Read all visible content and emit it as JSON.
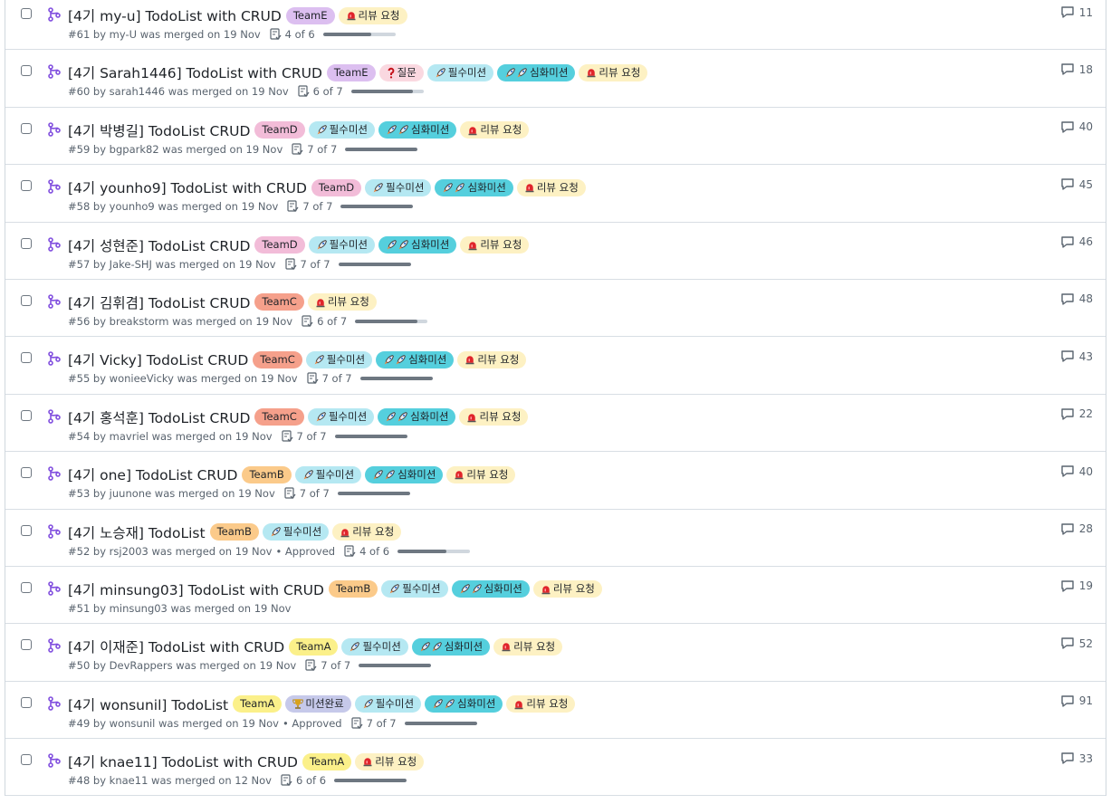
{
  "colors": {
    "teamE": "#dcbff0",
    "teamD": "#f2bcd8",
    "teamC": "#f5a08b",
    "teamB": "#fbca8a",
    "teamA": "#fbf08a",
    "review": "#fdf1c3",
    "question": "#fad8e0",
    "required": "#b5e8f2",
    "advanced": "#55cfdd",
    "done": "#c6c9ea"
  },
  "pull_requests": [
    {
      "title": "[4기 my-u] TodoList with CRUD",
      "labels": [
        {
          "text": "TeamE",
          "kind": "teamE"
        },
        {
          "text": "리뷰 요청",
          "kind": "review",
          "icon": "siren"
        }
      ],
      "meta": "#61 by my-U was merged on 19 Nov",
      "approved": "",
      "tasks": "4 of 6",
      "progress": 0.667,
      "comments": "11"
    },
    {
      "title": "[4기 Sarah1446] TodoList with CRUD",
      "labels": [
        {
          "text": "TeamE",
          "kind": "teamE"
        },
        {
          "text": "질문",
          "kind": "question",
          "icon": "question"
        },
        {
          "text": "필수미션",
          "kind": "required",
          "icon": "rocket"
        },
        {
          "text": "심화미션",
          "kind": "advanced",
          "icon": "rocket2"
        },
        {
          "text": "리뷰 요청",
          "kind": "review",
          "icon": "siren"
        }
      ],
      "meta": "#60 by sarah1446 was merged on 19 Nov",
      "approved": "",
      "tasks": "6 of 7",
      "progress": 0.857,
      "comments": "18"
    },
    {
      "title": "[4기 박병길] TodoList CRUD",
      "labels": [
        {
          "text": "TeamD",
          "kind": "teamD"
        },
        {
          "text": "필수미션",
          "kind": "required",
          "icon": "rocket"
        },
        {
          "text": "심화미션",
          "kind": "advanced",
          "icon": "rocket2"
        },
        {
          "text": "리뷰 요청",
          "kind": "review",
          "icon": "siren"
        }
      ],
      "meta": "#59 by bgpark82 was merged on 19 Nov",
      "approved": "",
      "tasks": "7 of 7",
      "progress": 1,
      "comments": "40"
    },
    {
      "title": "[4기 younho9] TodoList with CRUD",
      "labels": [
        {
          "text": "TeamD",
          "kind": "teamD"
        },
        {
          "text": "필수미션",
          "kind": "required",
          "icon": "rocket"
        },
        {
          "text": "심화미션",
          "kind": "advanced",
          "icon": "rocket2"
        },
        {
          "text": "리뷰 요청",
          "kind": "review",
          "icon": "siren"
        }
      ],
      "meta": "#58 by younho9 was merged on 19 Nov",
      "approved": "",
      "tasks": "7 of 7",
      "progress": 1,
      "comments": "45"
    },
    {
      "title": "[4기 성현준] TodoList CRUD",
      "labels": [
        {
          "text": "TeamD",
          "kind": "teamD"
        },
        {
          "text": "필수미션",
          "kind": "required",
          "icon": "rocket"
        },
        {
          "text": "심화미션",
          "kind": "advanced",
          "icon": "rocket2"
        },
        {
          "text": "리뷰 요청",
          "kind": "review",
          "icon": "siren"
        }
      ],
      "meta": "#57 by Jake-SHJ was merged on 19 Nov",
      "approved": "",
      "tasks": "7 of 7",
      "progress": 1,
      "comments": "46"
    },
    {
      "title": "[4기 김휘겸] TodoList CRUD",
      "labels": [
        {
          "text": "TeamC",
          "kind": "teamC"
        },
        {
          "text": "리뷰 요청",
          "kind": "review",
          "icon": "siren"
        }
      ],
      "meta": "#56 by breakstorm was merged on 19 Nov",
      "approved": "",
      "tasks": "6 of 7",
      "progress": 0.857,
      "comments": "48"
    },
    {
      "title": "[4기 Vicky] TodoList CRUD",
      "labels": [
        {
          "text": "TeamC",
          "kind": "teamC"
        },
        {
          "text": "필수미션",
          "kind": "required",
          "icon": "rocket"
        },
        {
          "text": "심화미션",
          "kind": "advanced",
          "icon": "rocket2"
        },
        {
          "text": "리뷰 요청",
          "kind": "review",
          "icon": "siren"
        }
      ],
      "meta": "#55 by wonieeVicky was merged on 19 Nov",
      "approved": "",
      "tasks": "7 of 7",
      "progress": 1,
      "comments": "43"
    },
    {
      "title": "[4기 홍석훈] TodoList CRUD",
      "labels": [
        {
          "text": "TeamC",
          "kind": "teamC"
        },
        {
          "text": "필수미션",
          "kind": "required",
          "icon": "rocket"
        },
        {
          "text": "심화미션",
          "kind": "advanced",
          "icon": "rocket2"
        },
        {
          "text": "리뷰 요청",
          "kind": "review",
          "icon": "siren"
        }
      ],
      "meta": "#54 by mavriel was merged on 19 Nov",
      "approved": "",
      "tasks": "7 of 7",
      "progress": 1,
      "comments": "22"
    },
    {
      "title": "[4기 one] TodoList CRUD",
      "labels": [
        {
          "text": "TeamB",
          "kind": "teamB"
        },
        {
          "text": "필수미션",
          "kind": "required",
          "icon": "rocket"
        },
        {
          "text": "심화미션",
          "kind": "advanced",
          "icon": "rocket2"
        },
        {
          "text": "리뷰 요청",
          "kind": "review",
          "icon": "siren"
        }
      ],
      "meta": "#53 by juunone was merged on 19 Nov",
      "approved": "",
      "tasks": "7 of 7",
      "progress": 1,
      "comments": "40"
    },
    {
      "title": "[4기 노승재] TodoList",
      "labels": [
        {
          "text": "TeamB",
          "kind": "teamB"
        },
        {
          "text": "필수미션",
          "kind": "required",
          "icon": "rocket"
        },
        {
          "text": "리뷰 요청",
          "kind": "review",
          "icon": "siren"
        }
      ],
      "meta": "#52 by rsj2003 was merged on 19 Nov",
      "approved": "• Approved",
      "tasks": "4 of 6",
      "progress": 0.667,
      "comments": "28"
    },
    {
      "title": "[4기 minsung03] TodoList with CRUD",
      "labels": [
        {
          "text": "TeamB",
          "kind": "teamB"
        },
        {
          "text": "필수미션",
          "kind": "required",
          "icon": "rocket"
        },
        {
          "text": "심화미션",
          "kind": "advanced",
          "icon": "rocket2"
        },
        {
          "text": "리뷰 요청",
          "kind": "review",
          "icon": "siren"
        }
      ],
      "meta": "#51 by minsung03 was merged on 19 Nov",
      "approved": "",
      "tasks": "",
      "progress": null,
      "comments": "19"
    },
    {
      "title": "[4기 이재준] TodoList with CRUD",
      "labels": [
        {
          "text": "TeamA",
          "kind": "teamA"
        },
        {
          "text": "필수미션",
          "kind": "required",
          "icon": "rocket"
        },
        {
          "text": "심화미션",
          "kind": "advanced",
          "icon": "rocket2"
        },
        {
          "text": "리뷰 요청",
          "kind": "review",
          "icon": "siren"
        }
      ],
      "meta": "#50 by DevRappers was merged on 19 Nov",
      "approved": "",
      "tasks": "7 of 7",
      "progress": 1,
      "comments": "52"
    },
    {
      "title": "[4기 wonsunil] TodoList",
      "labels": [
        {
          "text": "TeamA",
          "kind": "teamA"
        },
        {
          "text": "미션완료",
          "kind": "done",
          "icon": "trophy"
        },
        {
          "text": "필수미션",
          "kind": "required",
          "icon": "rocket"
        },
        {
          "text": "심화미션",
          "kind": "advanced",
          "icon": "rocket2"
        },
        {
          "text": "리뷰 요청",
          "kind": "review",
          "icon": "siren"
        }
      ],
      "meta": "#49 by wonsunil was merged on 19 Nov",
      "approved": "• Approved",
      "tasks": "7 of 7",
      "progress": 1,
      "comments": "91"
    },
    {
      "title": "[4기 knae11] TodoList with CRUD",
      "labels": [
        {
          "text": "TeamA",
          "kind": "teamA"
        },
        {
          "text": "리뷰 요청",
          "kind": "review",
          "icon": "siren"
        }
      ],
      "meta": "#48 by knae11 was merged on 12 Nov",
      "approved": "",
      "tasks": "6 of 6",
      "progress": 1,
      "comments": "33"
    }
  ]
}
